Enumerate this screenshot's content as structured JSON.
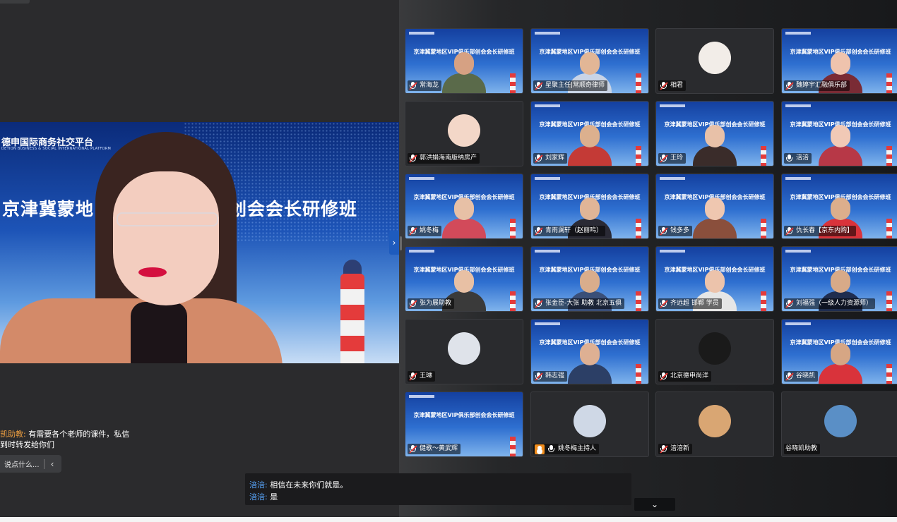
{
  "speaker": {
    "logo": "德申国际商务社交平台",
    "logo_sub": "DETION BUSINESS & SOCIAL INTERNATIONAL PLATFORM",
    "title_left": "京津冀蒙地",
    "title_right": "部创会会长研修班"
  },
  "chat_left": {
    "sender": "凯助教:",
    "line1": "有需要各个老师的课件，私信",
    "line2": "到时转发给你们"
  },
  "input": {
    "placeholder": "说点什么..."
  },
  "chat_bottom": [
    {
      "sender": "涪涪:",
      "text": "相信在未来你们就是。"
    },
    {
      "sender": "涪涪:",
      "text": "是"
    }
  ],
  "tile_banner": "京津冀蒙地区VIP俱乐部创会会长研修班",
  "participants": [
    {
      "name": "常海龙",
      "bg": "blue",
      "mic": "muted",
      "skin": "#d6a183",
      "cloth": "#5a6a4a"
    },
    {
      "name": "星聚主任|常顺奇律师",
      "bg": "blue",
      "mic": "muted",
      "skin": "#e2b696",
      "cloth": "#c9d4e6"
    },
    {
      "name": "相君",
      "bg": "dark",
      "mic": "muted",
      "avatar": "#f2ede8"
    },
    {
      "name": "魏婷宇汇融俱乐部",
      "bg": "blue",
      "mic": "muted",
      "skin": "#efc3ad",
      "cloth": "#7a2b35"
    },
    {
      "name": "郭洪娟海南版纳房产",
      "bg": "dark",
      "mic": "muted",
      "avatar": "#f3d7c8"
    },
    {
      "name": "刘家辉",
      "bg": "blue",
      "mic": "muted",
      "skin": "#dcb08e",
      "cloth": "#c43a36"
    },
    {
      "name": "王玲",
      "bg": "blue",
      "mic": "muted",
      "skin": "#e8c1a8",
      "cloth": "#3a2c2a"
    },
    {
      "name": "涪涪",
      "bg": "blue",
      "mic": "on",
      "skin": "#f1c9b6",
      "cloth": "#b73847"
    },
    {
      "name": "姚冬梅",
      "bg": "blue",
      "mic": "muted",
      "skin": "#e7c0a6",
      "cloth": "#d24a5a"
    },
    {
      "name": "青雨澜轩（赵丽鸣）",
      "bg": "blue",
      "mic": "muted",
      "skin": "#e0b597",
      "cloth": "#2a2a35"
    },
    {
      "name": "钱多多",
      "bg": "blue",
      "mic": "muted",
      "skin": "#efc7b0",
      "cloth": "#8a4f3c"
    },
    {
      "name": "仇长春【京东内购】",
      "bg": "blue",
      "mic": "muted",
      "skin": "#dcae8c",
      "cloth": "#d9333b"
    },
    {
      "name": "张为展助教",
      "bg": "blue",
      "mic": "muted",
      "skin": "#e8c0a4",
      "cloth": "#3a3a3a"
    },
    {
      "name": "张金臣-大张 助教 北京五俱",
      "bg": "blue",
      "mic": "muted",
      "skin": "#d9ad8c",
      "cloth": "#3a4f78"
    },
    {
      "name": "齐远超 邯郸 学员",
      "bg": "blue",
      "mic": "muted",
      "skin": "#ecc3ab",
      "cloth": "#e6e6e6"
    },
    {
      "name": "刘福强（一级人力资源师）",
      "bg": "blue",
      "mic": "muted",
      "skin": "#d8aa88",
      "cloth": "#1f2d4f"
    },
    {
      "name": "王琳",
      "bg": "dark",
      "mic": "muted",
      "avatar": "#dfe3ea"
    },
    {
      "name": "韩志强",
      "bg": "blue",
      "mic": "muted",
      "skin": "#deb093",
      "cloth": "#2c3f66"
    },
    {
      "name": "北京德申尚洋",
      "bg": "dark",
      "mic": "muted",
      "avatar": "#1a1a1a"
    },
    {
      "name": "谷晓凯",
      "bg": "blue",
      "mic": "muted",
      "skin": "#d6a684",
      "cloth": "#d9333b"
    },
    {
      "name": "健歌～黄武辉",
      "bg": "blue",
      "mic": "muted",
      "skin": "",
      "cloth": ""
    },
    {
      "name": "姚冬梅主持人",
      "bg": "dark",
      "mic": "host",
      "avatar": "#cfd8e6"
    },
    {
      "name": "涪涪新",
      "bg": "dark",
      "mic": "muted",
      "avatar": "#d9a673"
    },
    {
      "name": "谷晓凯助教",
      "bg": "dark",
      "mic": "none",
      "avatar": "#5a8fc6"
    }
  ]
}
